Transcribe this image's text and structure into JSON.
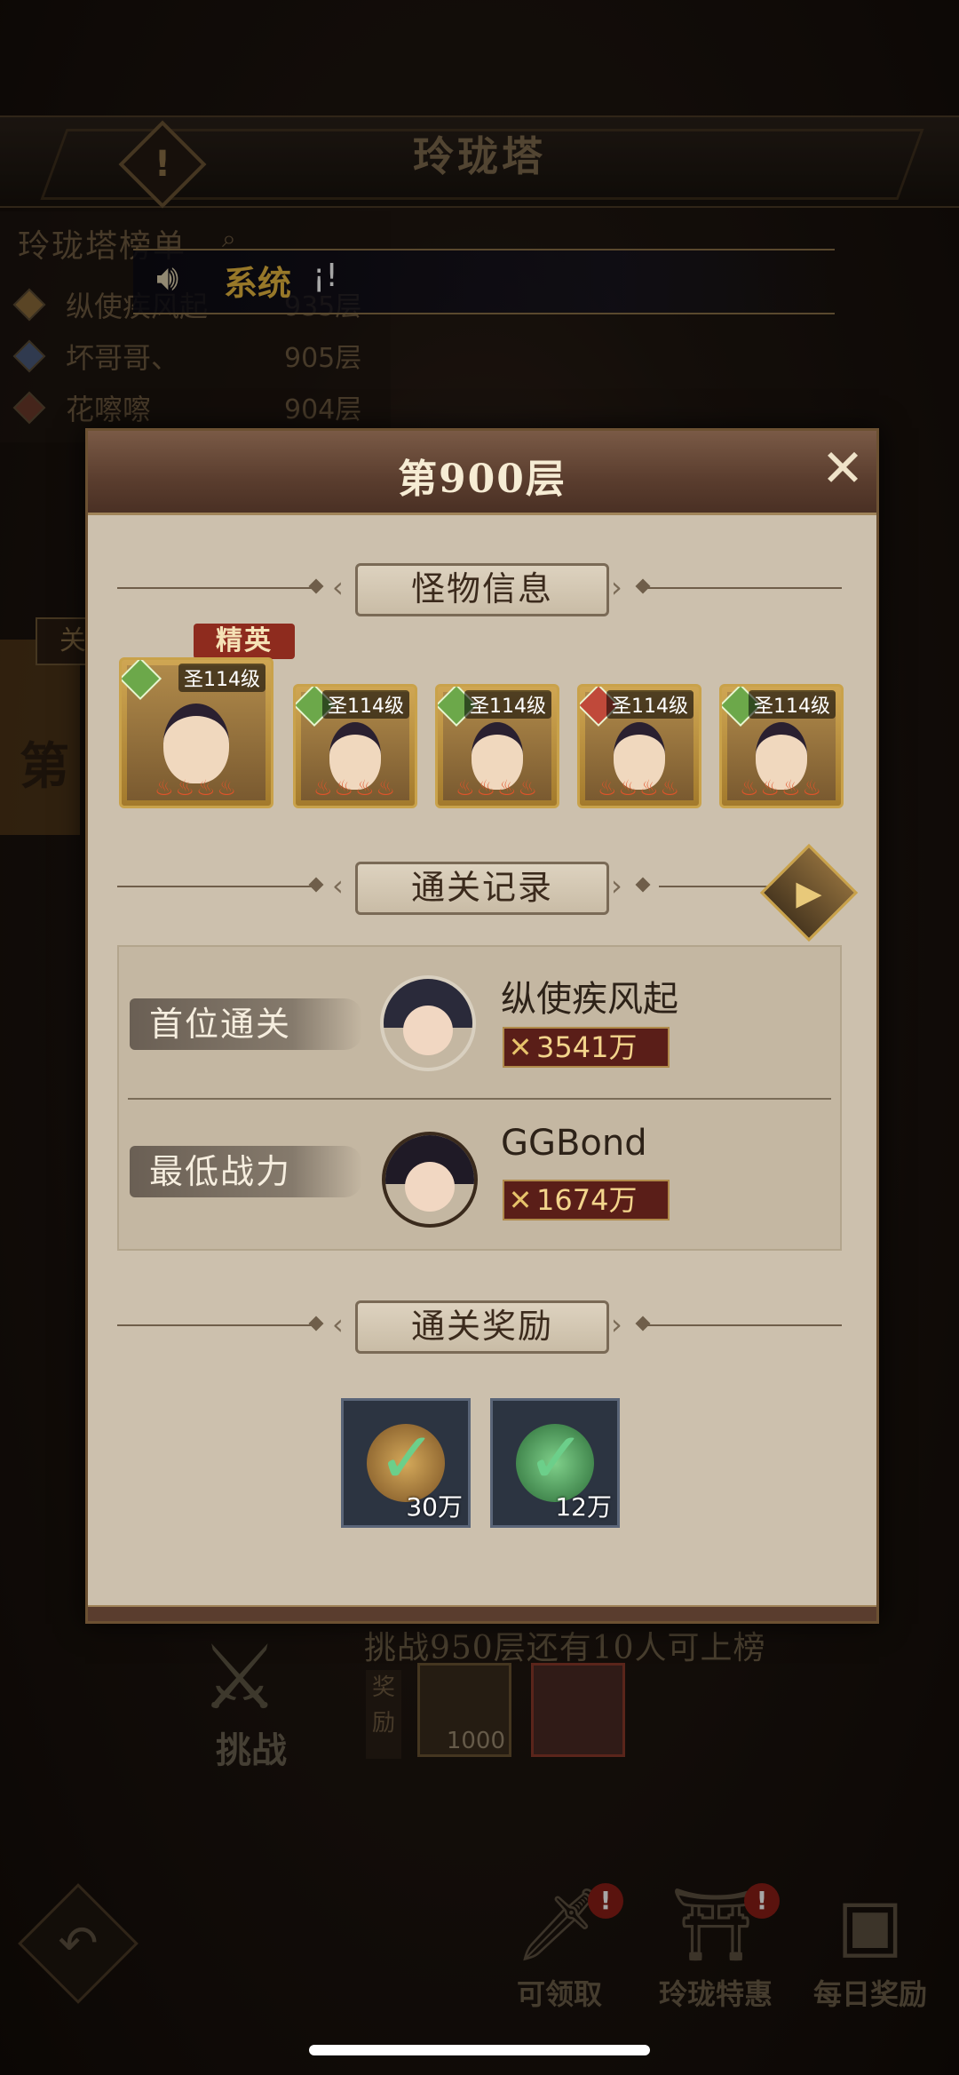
{
  "background": {
    "title": "玲珑塔",
    "help_icon": "!",
    "ranking": {
      "title": "玲珑塔榜单",
      "search_icon": "search-icon",
      "entries": [
        {
          "rank": "1",
          "name": "纵使疾风起",
          "floor": "935层"
        },
        {
          "rank": "2",
          "name": "坏哥哥、",
          "floor": "905层"
        },
        {
          "rank": "3",
          "name": "花嚓嚓",
          "floor": "904层"
        }
      ]
    },
    "system_broadcast": {
      "label": "系统",
      "text": "¡!"
    },
    "side_tab": "关",
    "side_text": "第",
    "challenge_hint": "挑战950层还有10人可上榜",
    "challenge_label": "挑战",
    "reward_tag": "奖励",
    "reward_items": [
      {
        "count": "1000"
      },
      {
        "count": ""
      }
    ],
    "bottom_buttons": [
      {
        "label": "可领取",
        "badge": "!"
      },
      {
        "label": "玲珑特惠",
        "badge": "!"
      },
      {
        "label": "每日奖励",
        "badge": ""
      }
    ]
  },
  "modal": {
    "title": "第900层",
    "close_icon": "✕",
    "monster_section": "怪物信息",
    "elite_tag": "精英",
    "monsters": [
      {
        "level": "圣114级",
        "stars": "♨♨♨♨",
        "badge_color": "#6ca84a"
      },
      {
        "level": "圣114级",
        "stars": "♨♨♨♨",
        "badge_color": "#6ca84a"
      },
      {
        "level": "圣114级",
        "stars": "♨♨♨♨",
        "badge_color": "#6ca84a"
      },
      {
        "level": "圣114级",
        "stars": "♨♨♨♨",
        "badge_color": "#c0493a"
      },
      {
        "level": "圣114级",
        "stars": "♨♨♨♨",
        "badge_color": "#6ca84a"
      }
    ],
    "record_section": "通关记录",
    "records": [
      {
        "label": "首位通关",
        "name": "纵使疾风起",
        "power": "3541万"
      },
      {
        "label": "最低战力",
        "name": "GGBond",
        "power": "1674万"
      }
    ],
    "reward_section": "通关奖励",
    "rewards": [
      {
        "count": "30万",
        "color": "#a17a3e"
      },
      {
        "count": "12万",
        "color": "#3f8a4a"
      }
    ]
  },
  "colors": {
    "accent_gold": "#c9a24a",
    "header_brown": "#5a3d2e",
    "panel_beige": "#ccc0ad"
  }
}
